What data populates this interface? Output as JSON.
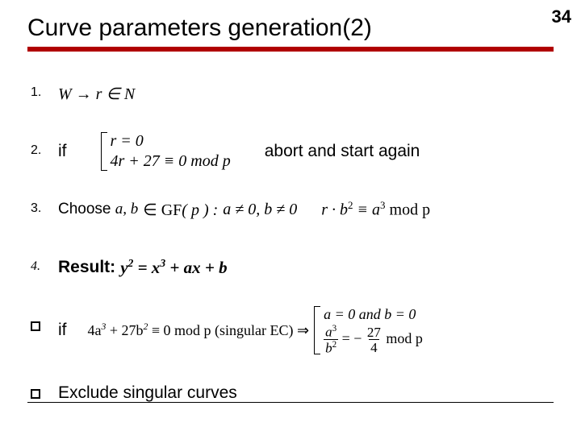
{
  "page_number": "34",
  "title": "Curve parameters generation(2)",
  "steps": {
    "s1": {
      "marker": "1.",
      "math": "W → r ∈ N"
    },
    "s2": {
      "marker": "2.",
      "kw": "if",
      "cond_top": "r = 0",
      "cond_bot": "4r + 27 ≡ 0 mod p",
      "tail": "abort and start again"
    },
    "s3": {
      "marker": "3.",
      "kw": "Choose ",
      "vars": "a, b",
      "in": " ∈ GF",
      "gfp": "( p ) :",
      "cond1": " a ≠ 0, b ≠ 0",
      "cond2_lhs": "r · b",
      "cond2_exp1": "2",
      "cond2_mid": " ≡ a",
      "cond2_exp2": "3",
      "cond2_rhs": " mod p"
    },
    "s4": {
      "marker": "4.",
      "label": "Result: ",
      "eq_y": "y",
      "eq_y_exp": "2",
      "eq_eq": " = x",
      "eq_x3_exp": "3",
      "eq_rest": " + ax + b"
    },
    "s5": {
      "kw": "if",
      "cond": "4a",
      "cond_exp1": "3",
      "cond_mid": " + 27b",
      "cond_exp2": "2",
      "cond_tail": " ≡ 0 mod p (singular EC) ⇒",
      "r_top": "a = 0 and b = 0",
      "r_frac_num": "a",
      "r_frac_num_exp": "3",
      "r_frac_den": "b",
      "r_frac_den_exp": "2",
      "r_eq": " = −",
      "r_frac2_num": "27",
      "r_frac2_den": "4",
      "r_tail": " mod p"
    },
    "s6": {
      "text": "Exclude singular curves"
    }
  }
}
